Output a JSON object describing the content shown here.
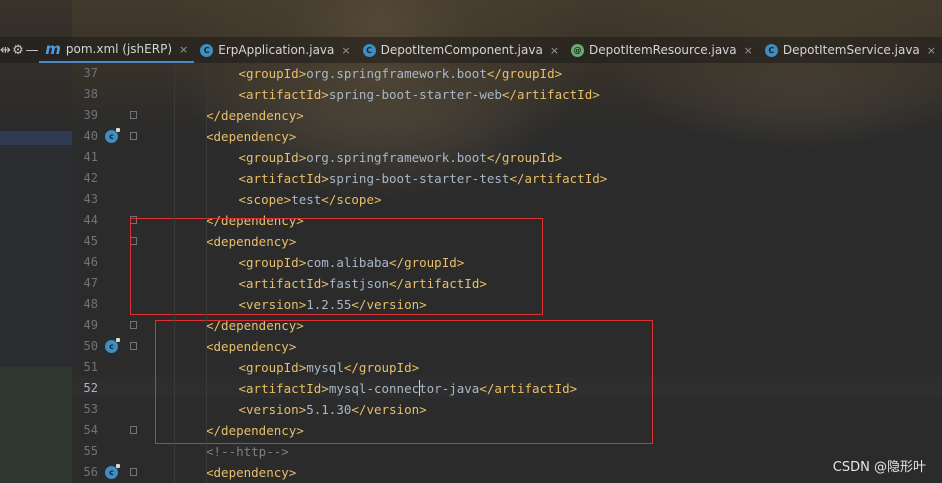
{
  "tabs": [
    {
      "icon": "m",
      "label": "pom.xml (jshERP)",
      "active": true
    },
    {
      "icon": "c",
      "label": "ErpApplication.java",
      "active": false
    },
    {
      "icon": "c",
      "label": "DepotItemComponent.java",
      "active": false
    },
    {
      "icon": "spring",
      "label": "DepotItemResource.java",
      "active": false
    },
    {
      "icon": "c",
      "label": "DepotItemService.java",
      "active": false
    }
  ],
  "toolbar": {
    "settings_glyph": "⚙",
    "minimize_glyph": "—",
    "close_glyph": "×"
  },
  "editor": {
    "current_line": "52",
    "lines": [
      {
        "num": "37",
        "indent": 2,
        "parts": [
          [
            "tag",
            "<groupId>"
          ],
          [
            "txt",
            "org.springframework.boot"
          ],
          [
            "tag",
            "</groupId>"
          ]
        ]
      },
      {
        "num": "38",
        "indent": 2,
        "parts": [
          [
            "tag",
            "<artifactId>"
          ],
          [
            "txt",
            "spring-boot-starter-web"
          ],
          [
            "tag",
            "</artifactId>"
          ]
        ]
      },
      {
        "num": "39",
        "indent": 1,
        "parts": [
          [
            "tag",
            "</dependency>"
          ]
        ]
      },
      {
        "num": "40",
        "indent": 1,
        "parts": [
          [
            "tag",
            "<dependency>"
          ]
        ]
      },
      {
        "num": "41",
        "indent": 2,
        "parts": [
          [
            "tag",
            "<groupId>"
          ],
          [
            "txt",
            "org.springframework.boot"
          ],
          [
            "tag",
            "</groupId>"
          ]
        ]
      },
      {
        "num": "42",
        "indent": 2,
        "parts": [
          [
            "tag",
            "<artifactId>"
          ],
          [
            "txt",
            "spring-boot-starter-test"
          ],
          [
            "tag",
            "</artifactId>"
          ]
        ]
      },
      {
        "num": "43",
        "indent": 2,
        "parts": [
          [
            "tag",
            "<scope>"
          ],
          [
            "txt",
            "test"
          ],
          [
            "tag",
            "</scope>"
          ]
        ]
      },
      {
        "num": "44",
        "indent": 1,
        "parts": [
          [
            "tag",
            "</dependency>"
          ]
        ]
      },
      {
        "num": "45",
        "indent": 1,
        "parts": [
          [
            "tag",
            "<dependency>"
          ]
        ]
      },
      {
        "num": "46",
        "indent": 2,
        "parts": [
          [
            "tag",
            "<groupId>"
          ],
          [
            "txt",
            "com.alibaba"
          ],
          [
            "tag",
            "</groupId>"
          ]
        ]
      },
      {
        "num": "47",
        "indent": 2,
        "parts": [
          [
            "tag",
            "<artifactId>"
          ],
          [
            "txt",
            "fastjson"
          ],
          [
            "tag",
            "</artifactId>"
          ]
        ]
      },
      {
        "num": "48",
        "indent": 2,
        "parts": [
          [
            "tag",
            "<version>"
          ],
          [
            "txt",
            "1.2.55"
          ],
          [
            "tag",
            "</version>"
          ]
        ]
      },
      {
        "num": "49",
        "indent": 1,
        "parts": [
          [
            "tag",
            "</dependency>"
          ]
        ]
      },
      {
        "num": "50",
        "indent": 1,
        "parts": [
          [
            "tag",
            "<dependency>"
          ]
        ]
      },
      {
        "num": "51",
        "indent": 2,
        "parts": [
          [
            "tag",
            "<groupId>"
          ],
          [
            "txt",
            "mysql"
          ],
          [
            "tag",
            "</groupId>"
          ]
        ]
      },
      {
        "num": "52",
        "indent": 2,
        "parts": [
          [
            "tag",
            "<artifactId>"
          ],
          [
            "txt",
            "mysql-connector-java"
          ],
          [
            "tag",
            "</artifactId>"
          ]
        ]
      },
      {
        "num": "53",
        "indent": 2,
        "parts": [
          [
            "tag",
            "<version>"
          ],
          [
            "txt",
            "5.1.30"
          ],
          [
            "tag",
            "</version>"
          ]
        ]
      },
      {
        "num": "54",
        "indent": 1,
        "parts": [
          [
            "tag",
            "</dependency>"
          ]
        ]
      },
      {
        "num": "55",
        "indent": 1,
        "parts": [
          [
            "cmt",
            "<!--http-->"
          ]
        ]
      },
      {
        "num": "56",
        "indent": 1,
        "parts": [
          [
            "tag",
            "<dependency>"
          ]
        ]
      }
    ],
    "gutter_icons_on": [
      "40",
      "50",
      "56"
    ],
    "fold_markers_on": [
      "39",
      "40",
      "44",
      "45",
      "49",
      "50",
      "54",
      "56"
    ]
  },
  "colors": {
    "tag": "#e8bf6a",
    "text": "#a9b7c6",
    "comment": "#808080",
    "highlight_box": "#e03030",
    "background": "#2b2b2b"
  },
  "watermark": "CSDN @隐形叶"
}
